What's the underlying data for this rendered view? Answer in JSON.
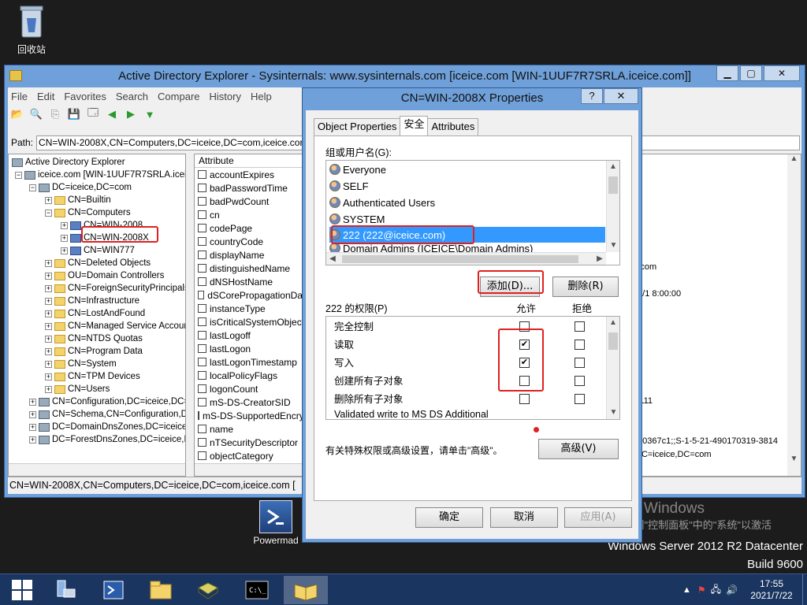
{
  "desktop": {
    "recycle_bin": "回收站",
    "powermad": "Powermad",
    "watermark_line1": "激活 Windows",
    "watermark_line2": "转到\"控制面板\"中的\"系统\"以激活",
    "watermark_line3": "Windows。",
    "watermark_os": "Windows Server 2012 R2 Datacenter",
    "watermark_build": "Build 9600"
  },
  "main_window": {
    "title": "Active Directory Explorer - Sysinternals: www.sysinternals.com [iceice.com [WIN-1UUF7R7SRLA.iceice.com]]",
    "menu": [
      "File",
      "Edit",
      "Favorites",
      "Search",
      "Compare",
      "History",
      "Help"
    ],
    "path_label": "Path:",
    "path_value": "CN=WIN-2008X,CN=Computers,DC=iceice,DC=com,iceice.com [WIN",
    "tree": [
      {
        "label": "Active Directory Explorer",
        "level": 0
      },
      {
        "label": "iceice.com [WIN-1UUF7R7SRLA.iceice",
        "level": 1
      },
      {
        "label": "DC=iceice,DC=com",
        "level": 2
      },
      {
        "label": "CN=Builtin",
        "level": 3
      },
      {
        "label": "CN=Computers",
        "level": 3
      },
      {
        "label": "CN=WIN-2008",
        "level": 4
      },
      {
        "label": "CN=WIN-2008X",
        "level": 4
      },
      {
        "label": "CN=WIN777",
        "level": 4
      },
      {
        "label": "CN=Deleted Objects",
        "level": 3
      },
      {
        "label": "OU=Domain Controllers",
        "level": 3
      },
      {
        "label": "CN=ForeignSecurityPrincipals",
        "level": 3
      },
      {
        "label": "CN=Infrastructure",
        "level": 3
      },
      {
        "label": "CN=LostAndFound",
        "level": 3
      },
      {
        "label": "CN=Managed Service Accour",
        "level": 3
      },
      {
        "label": "CN=NTDS Quotas",
        "level": 3
      },
      {
        "label": "CN=Program Data",
        "level": 3
      },
      {
        "label": "CN=System",
        "level": 3
      },
      {
        "label": "CN=TPM Devices",
        "level": 3
      },
      {
        "label": "CN=Users",
        "level": 3
      },
      {
        "label": "CN=Configuration,DC=iceice,DC=",
        "level": 2
      },
      {
        "label": "CN=Schema,CN=Configuration,D",
        "level": 2
      },
      {
        "label": "DC=DomainDnsZones,DC=iceice,",
        "level": 2
      },
      {
        "label": "DC=ForestDnsZones,DC=iceice,D",
        "level": 2
      }
    ],
    "attr_header": "Attribute",
    "attributes": [
      "accountExpires",
      "badPasswordTime",
      "badPwdCount",
      "cn",
      "codePage",
      "countryCode",
      "displayName",
      "distinguishedName",
      "dNSHostName",
      "dSCorePropagationData",
      "instanceType",
      "isCriticalSystemObject",
      "lastLogoff",
      "lastLogon",
      "lastLogonTimestamp",
      "localPolicyFlags",
      "logonCount",
      "mS-DS-CreatorSID",
      "mS-DS-SupportedEncryp...",
      "name",
      "nTSecurityDescriptor",
      "objectCategory"
    ],
    "value_fragments": {
      "v1": "=com",
      "v2": "/1/1 8:00:00",
      "v3": "1111",
      "v4": "f80367c1;;S-1-5-21-490170319-3814",
      "v5": "DC=iceice,DC=com"
    },
    "status": "CN=WIN-2008X,CN=Computers,DC=iceice,DC=com,iceice.com ["
  },
  "dialog": {
    "title": "CN=WIN-2008X Properties",
    "help_btn": "?",
    "close_btn": "✕",
    "tabs": [
      "Object Properties",
      "安全",
      "Attributes"
    ],
    "groups_label": "组或用户名(G):",
    "users": [
      "Everyone",
      "SELF",
      "Authenticated Users",
      "SYSTEM",
      "222 (222@iceice.com)",
      "Domain Admins (ICEICE\\Domain Admins)"
    ],
    "add_btn": "添加(D)...",
    "remove_btn": "删除(R)",
    "perm_label": "222 的权限(P)",
    "allow_label": "允许",
    "deny_label": "拒绝",
    "permissions": [
      {
        "name": "完全控制",
        "allow": false,
        "deny": false
      },
      {
        "name": "读取",
        "allow": true,
        "deny": false
      },
      {
        "name": "写入",
        "allow": true,
        "deny": false
      },
      {
        "name": "创建所有子对象",
        "allow": false,
        "deny": false
      },
      {
        "name": "删除所有子对象",
        "allow": false,
        "deny": false
      },
      {
        "name": "Validated write to MS DS Additional",
        "allow": true,
        "deny": false
      }
    ],
    "advanced_note": "有关特殊权限或高级设置，请单击\"高级\"。",
    "advanced_btn": "高级(V)",
    "ok_btn": "确定",
    "cancel_btn": "取消",
    "apply_btn": "应用(A)"
  },
  "taskbar": {
    "time": "17:55",
    "date": "2021/7/22"
  }
}
